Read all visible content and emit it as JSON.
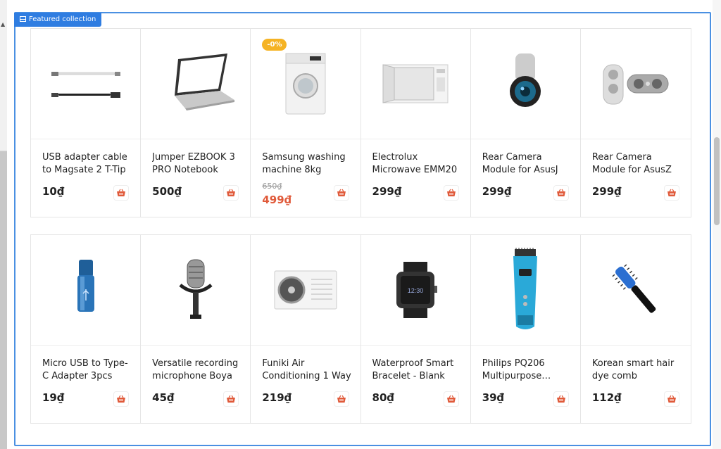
{
  "collection": {
    "label": "Featured collection"
  },
  "currency": "đ",
  "rows": [
    [
      {
        "title": "USB adapter cable to Magsate 2 T-Tip",
        "price": "10₫",
        "icon": "usb-cable-icon"
      },
      {
        "title": "Jumper EZBOOK 3 PRO Notebook",
        "price": "500₫",
        "icon": "laptop-icon"
      },
      {
        "title": "Samsung washing machine 8kg",
        "old_price": "650₫",
        "price": "499₫",
        "badge": "-0%",
        "icon": "washing-machine-icon"
      },
      {
        "title": "Electrolux Microwave EMM20",
        "price": "299₫",
        "icon": "microwave-icon"
      },
      {
        "title": "Rear Camera Module for AsusJ",
        "price": "299₫",
        "icon": "camera-lens-icon"
      },
      {
        "title": "Rear Camera Module for AsusZ",
        "price": "299₫",
        "icon": "camera-module-icon"
      }
    ],
    [
      {
        "title": "Micro USB to Type-C Adapter 3pcs",
        "price": "19₫",
        "icon": "usb-adapter-icon"
      },
      {
        "title": "Versatile recording microphone Boya",
        "price": "45₫",
        "icon": "microphone-icon"
      },
      {
        "title": "Funiki Air Conditioning 1 Way",
        "price": "219₫",
        "icon": "air-conditioner-icon"
      },
      {
        "title": "Waterproof Smart Bracelet - Blank",
        "price": "80₫",
        "icon": "smartwatch-icon"
      },
      {
        "title": "Philips PQ206 Multipurpose…",
        "price": "39₫",
        "icon": "hair-clipper-icon"
      },
      {
        "title": "Korean smart hair dye comb",
        "price": "112₫",
        "icon": "hair-comb-icon"
      }
    ]
  ],
  "colors": {
    "frame": "#4a90e2",
    "tag": "#2f7de1",
    "sale": "#e05a3a",
    "badge": "#f5b324",
    "cart": "#e05a3a"
  }
}
